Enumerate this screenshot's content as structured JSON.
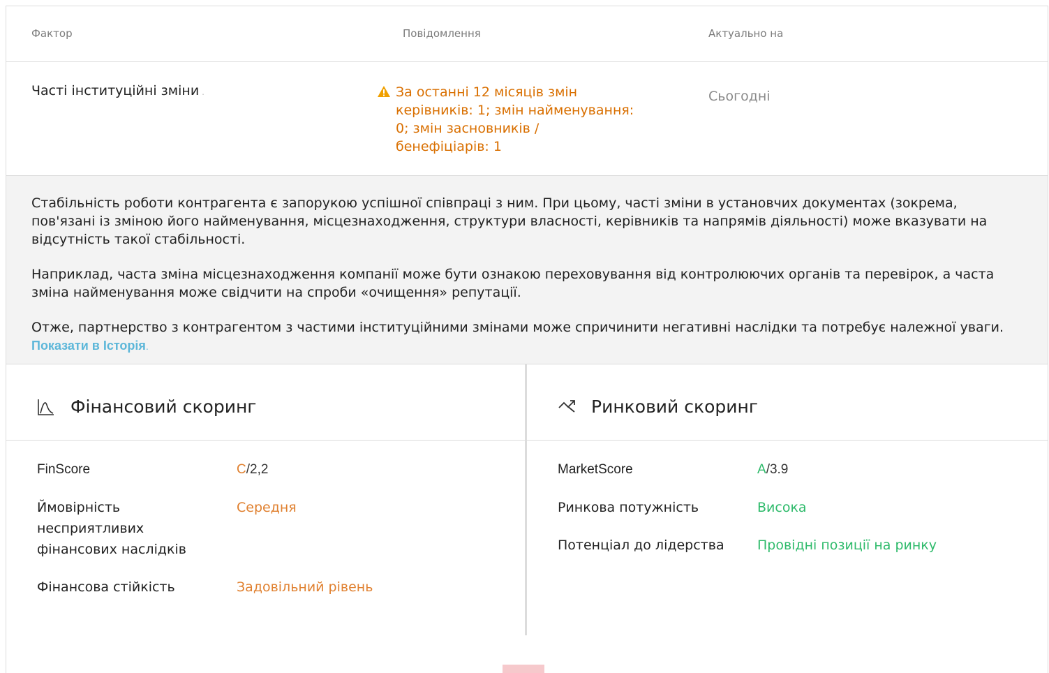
{
  "table": {
    "headers": [
      "Фактор",
      "Повідомлення",
      "Актуально на"
    ],
    "row": {
      "factor": "Часті інституційні зміни",
      "message": "За останні 12 місяців змін керівників: 1; змін найменування: 0; змін засновників / бенефіціарів: 1",
      "date": "Сьогодні"
    }
  },
  "description": {
    "p1": "Стабільність роботи контрагента є запорукою успішної співпраці з ним. При цьому, часті зміни в установчих документах (зокрема, пов'язані із зміною його найменування, місцезнаходження, структури власності, керівників та напрямів діяльності) може вказувати на відсутність такої стабільності.",
    "p2": "Наприклад, часта зміна місцезнаходження компанії може бути ознакою переховування від контролюючих органів та перевірок, а часта зміна найменування може свідчити на спроби «очищення» репутації.",
    "p3": "Отже, партнерство з контрагентом з частими інституційними змінами може спричинити негативні наслідки та потребує належної уваги.",
    "link": "Показати в Історія",
    "link_dot": "."
  },
  "financial": {
    "title": "Фінансовий скоринг",
    "icon": "chart-curve-icon",
    "stats": [
      {
        "label": "FinScore",
        "grade": "C",
        "rest": "/2,2"
      },
      {
        "label": "Ймовірність несприятливих фінансових наслідків",
        "value": "Середня"
      },
      {
        "label": "Фінансова стійкість",
        "value": "Задовільний рівень"
      }
    ]
  },
  "market": {
    "title": "Ринковий скоринг",
    "icon": "trend-zigzag-icon",
    "stats": [
      {
        "label": "MarketScore",
        "grade": "A",
        "rest": "/3.9"
      },
      {
        "label": "Ринкова потужність",
        "value": "Висока"
      },
      {
        "label": "Потенціал до лідерства",
        "value": "Провідні позиції на ринку"
      }
    ]
  },
  "colors": {
    "warning": "#d96f00",
    "orange": "#e0802f",
    "green": "#2dba6a",
    "link": "#5db7d9"
  }
}
